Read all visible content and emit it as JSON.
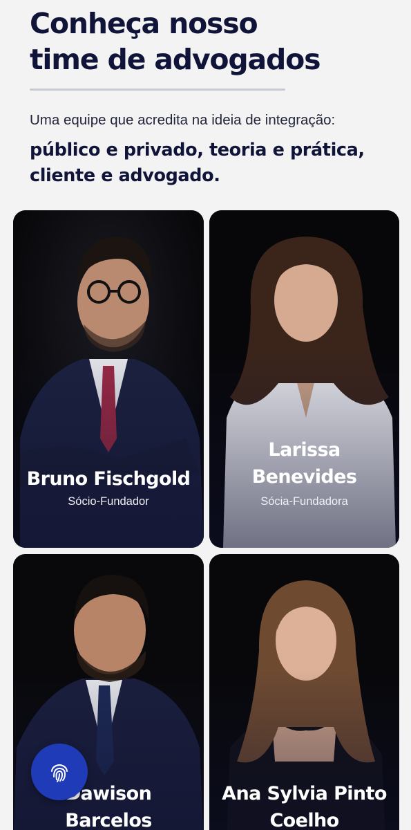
{
  "header": {
    "title_line1": "Conheça nosso",
    "title_line2": "time de advogados"
  },
  "intro": {
    "text": "Uma equipe que acredita na ideia de integração:",
    "highlight_line1": "público e privado, teoria e prática,",
    "highlight_line2": "cliente e advogado."
  },
  "team": [
    {
      "name": "Bruno Fischgold",
      "role": "Sócio-Fundador"
    },
    {
      "name_line1": "Larissa",
      "name_line2": "Benevides",
      "role": "Sócia-Fundadora"
    },
    {
      "name_line1": "Dawison",
      "name_line2": "Barcelos"
    },
    {
      "name_line1": "Ana Sylvia Pinto",
      "name_line2": "Coelho"
    }
  ],
  "fab": {
    "icon": "fingerprint-icon",
    "color": "#1f3bb8"
  },
  "colors": {
    "heading": "#0f1438",
    "background": "#f3f3f3"
  }
}
